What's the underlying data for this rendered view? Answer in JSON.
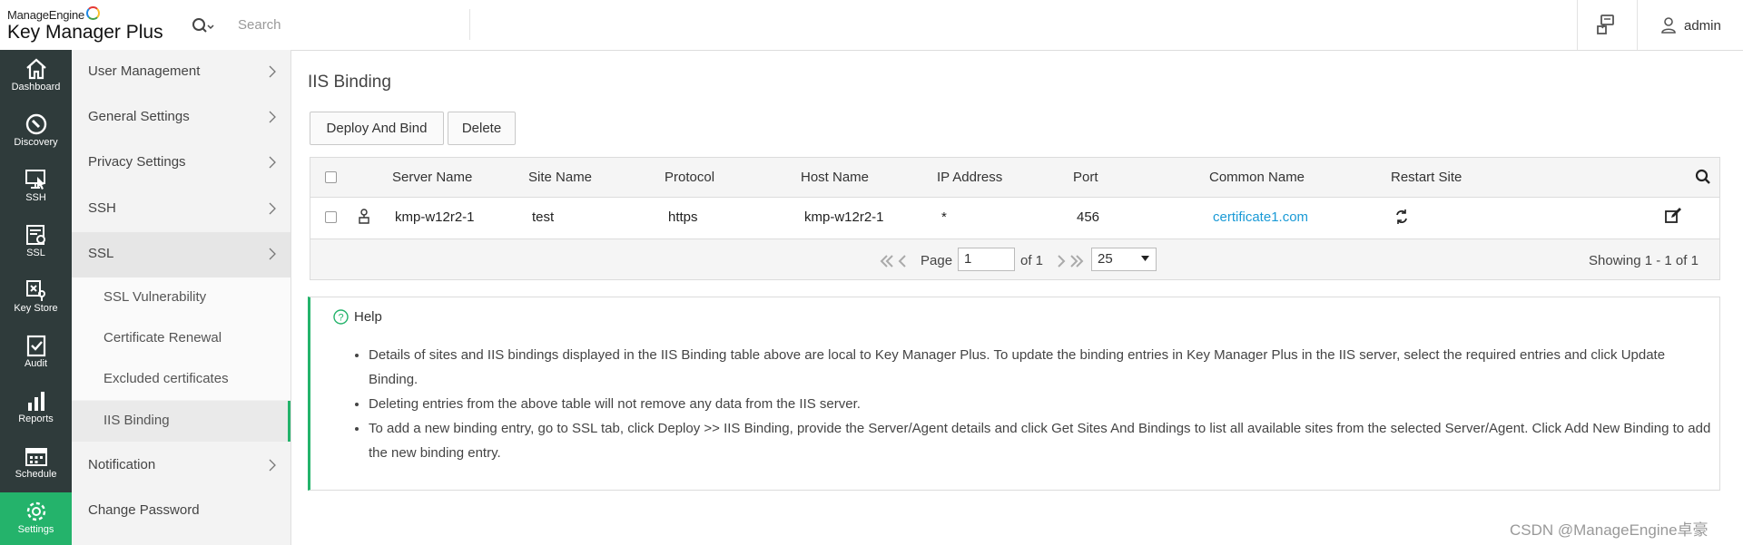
{
  "header": {
    "brand_top": "ManageEngine",
    "brand_product": "Key Manager Plus",
    "search_placeholder": "Search",
    "user_name": "admin"
  },
  "leftnav": [
    {
      "label": "Dashboard",
      "icon": "home-icon"
    },
    {
      "label": "Discovery",
      "icon": "discovery-icon"
    },
    {
      "label": "SSH",
      "icon": "ssh-icon"
    },
    {
      "label": "SSL",
      "icon": "ssl-icon"
    },
    {
      "label": "Key Store",
      "icon": "key-store-icon"
    },
    {
      "label": "Audit",
      "icon": "audit-icon"
    },
    {
      "label": "Reports",
      "icon": "reports-icon"
    },
    {
      "label": "Schedule",
      "icon": "schedule-icon"
    },
    {
      "label": "Settings",
      "icon": "settings-icon",
      "active": true
    }
  ],
  "subnav": {
    "items": [
      {
        "label": "User Management"
      },
      {
        "label": "General Settings"
      },
      {
        "label": "Privacy Settings"
      },
      {
        "label": "SSH"
      },
      {
        "label": "SSL"
      },
      {
        "label": "Notification"
      },
      {
        "label": "Change Password"
      }
    ],
    "ssl_children": [
      {
        "label": "SSL Vulnerability"
      },
      {
        "label": "Certificate Renewal"
      },
      {
        "label": "Excluded certificates"
      },
      {
        "label": "IIS Binding",
        "selected": true
      }
    ]
  },
  "main": {
    "title": "IIS Binding",
    "buttons": {
      "deploy": "Deploy And Bind",
      "delete": "Delete"
    },
    "table": {
      "columns": [
        "Server Name",
        "Site Name",
        "Protocol",
        "Host Name",
        "IP Address",
        "Port",
        "Common Name",
        "Restart Site"
      ],
      "rows": [
        {
          "server_name": "kmp-w12r2-1",
          "site_name": "test",
          "protocol": "https",
          "host_name": "kmp-w12r2-1",
          "ip_address": "*",
          "port": "456",
          "common_name": "certificate1.com"
        }
      ]
    },
    "pager": {
      "page_label": "Page",
      "page_value": "1",
      "of_label": "of 1",
      "per_page": "25",
      "showing": "Showing 1 - 1 of 1"
    },
    "help": {
      "title": "Help",
      "bullets": [
        "Details of sites and IIS bindings displayed in the IIS Binding table above are local to Key Manager Plus. To update the binding entries in Key Manager Plus in the IIS server, select the required entries and click Update Binding.",
        "Deleting entries from the above table will not remove any data from the IIS server.",
        "To add a new binding entry, go to SSL tab, click Deploy >> IIS Binding, provide the Server/Agent details and click Get Sites And Bindings to list all available sites from the selected Server/Agent. Click Add New Binding to add the new binding entry."
      ]
    }
  },
  "watermark": "CSDN @ManageEngine卓豪",
  "colors": {
    "accent": "#24b36b",
    "sidebar": "#2f3b3b",
    "link": "#1a9ad6"
  }
}
